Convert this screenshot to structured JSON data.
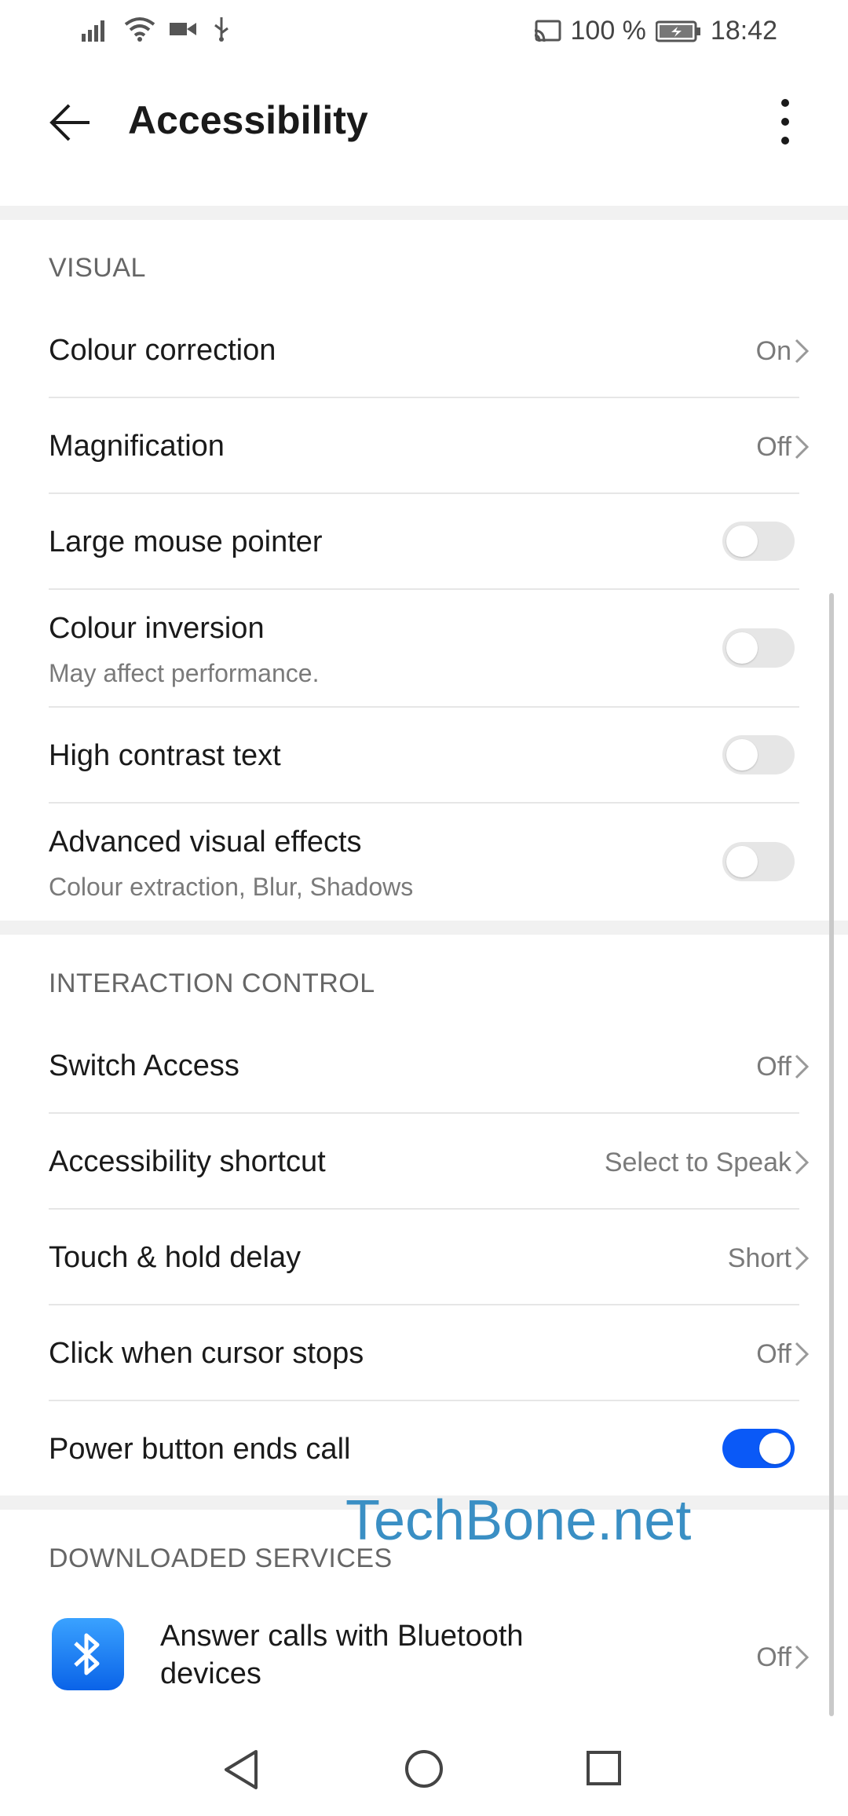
{
  "status_bar": {
    "battery": "100 %",
    "time": "18:42"
  },
  "header": {
    "title": "Accessibility"
  },
  "sections": {
    "visual": {
      "title": "VISUAL",
      "colour_correction": {
        "label": "Colour correction",
        "value": "On"
      },
      "magnification": {
        "label": "Magnification",
        "value": "Off"
      },
      "large_mouse_pointer": {
        "label": "Large mouse pointer",
        "enabled": false
      },
      "colour_inversion": {
        "label": "Colour inversion",
        "sub": "May affect performance.",
        "enabled": false
      },
      "high_contrast_text": {
        "label": "High contrast text",
        "enabled": false
      },
      "advanced_visual_effects": {
        "label": "Advanced visual effects",
        "sub": "Colour extraction, Blur, Shadows",
        "enabled": false
      }
    },
    "interaction": {
      "title": "INTERACTION CONTROL",
      "switch_access": {
        "label": "Switch Access",
        "value": "Off"
      },
      "accessibility_shortcut": {
        "label": "Accessibility shortcut",
        "value": "Select to Speak"
      },
      "touch_hold_delay": {
        "label": "Touch & hold delay",
        "value": "Short"
      },
      "click_cursor_stops": {
        "label": "Click when cursor stops",
        "value": "Off"
      },
      "power_button_ends_call": {
        "label": "Power button ends call",
        "enabled": true
      }
    },
    "downloaded": {
      "title": "DOWNLOADED SERVICES",
      "bluetooth_answer": {
        "label_line1": "Answer calls with Bluetooth",
        "label_line2": "devices",
        "value": "Off"
      }
    }
  },
  "watermark": "TechBone.net",
  "colors": {
    "accent": "#0a59f7",
    "section_gap": "#f1f1f1",
    "watermark": "#3a8fc4"
  }
}
